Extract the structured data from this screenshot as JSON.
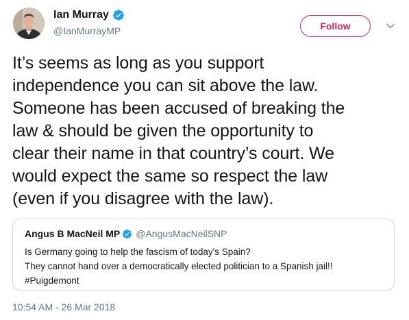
{
  "author": {
    "display_name": "Ian Murray",
    "handle": "@IanMurrayMP",
    "verified_icon": "verified-badge-icon",
    "avatar_icon": "profile-photo"
  },
  "header": {
    "follow_label": "Follow",
    "menu_icon": "chevron-down-icon"
  },
  "tweet": {
    "lines": [
      "It’s seems as long as you support",
      "independence you can sit above the law.",
      "Someone has been accused of breaking the",
      "law & should be given the opportunity to",
      "clear their name in that country’s court. We",
      "would expect the same so respect the law",
      "(even if you disagree with the law)."
    ]
  },
  "quoted_tweet": {
    "display_name": "Angus B MacNeil MP",
    "handle": "@AngusMacNeilSNP",
    "lines": [
      "Is Germany going to help the fascism of today's Spain?",
      "They cannot hand over a democratically elected politician to a Spanish jail!!",
      "#Puigdemont"
    ]
  },
  "timestamp": "10:54 AM - 26 Mar 2018",
  "colors": {
    "accent": "#e0245e",
    "verified": "#1da1f2",
    "muted_text": "#657786",
    "text": "#14171a",
    "border": "#ccd6dd"
  }
}
